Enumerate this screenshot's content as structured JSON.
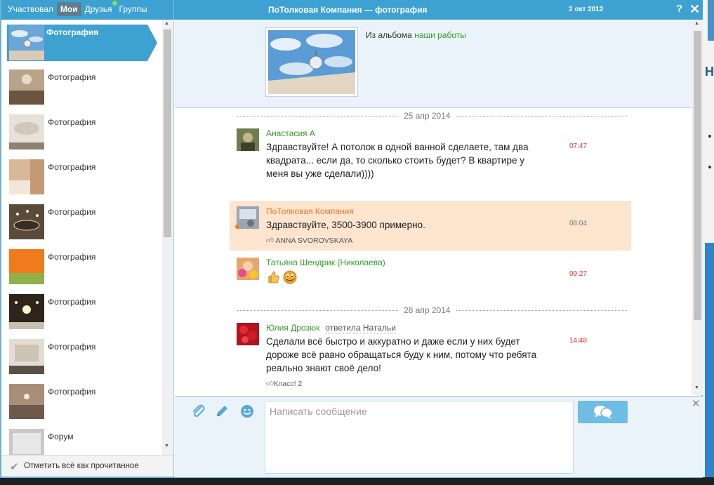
{
  "tabs": [
    {
      "label": "Участвовал",
      "active": false
    },
    {
      "label": "Мои",
      "active": true
    },
    {
      "label": "Друзья",
      "active": false,
      "online": true
    },
    {
      "label": "Группы",
      "active": false
    }
  ],
  "window": {
    "title": "ПоТолковая Компания — фотография",
    "date": "2 окт 2012",
    "help": "?",
    "close": "✕"
  },
  "sidebar": {
    "items": [
      {
        "label": "Фотография",
        "active": true
      },
      {
        "label": "Фотография"
      },
      {
        "label": "Фотография"
      },
      {
        "label": "Фотография"
      },
      {
        "label": "Фотография"
      },
      {
        "label": "Фотография"
      },
      {
        "label": "Фотография"
      },
      {
        "label": "Фотография"
      },
      {
        "label": "Фотография"
      },
      {
        "label": "Форум"
      }
    ],
    "mark_all_read": "Отметить всё как прочитанное"
  },
  "album": {
    "from_prefix": "Из альбома",
    "album_link": "наши работы"
  },
  "messages": {
    "day1": "25 апр 2014",
    "day2": "28 апр 2014",
    "m1": {
      "author": "Анастасия А",
      "text": "Здравствуйте! А потолок в одной ванной сделаете, там два квадрата... если да, то сколько стоить будет? В квартире у меня вы уже сделали))))",
      "time": "07:47"
    },
    "m2": {
      "author": "ПоТолковая Компания",
      "text": "Здравствуйте, 3500-3900 примерно.",
      "time": "08:04",
      "meta": "ANNA SVOROVSKAYA"
    },
    "m3": {
      "author": "Татьяна Шендрик (Николаева)",
      "time": "09:27"
    },
    "m4": {
      "author": "Юлия Дрозюк",
      "reply": "ответила Натальи",
      "text": "Сделали всё быстро и аккуратно и даже если у них будет дороже всё равно обращаться буду к ним, потому что ребята реально знают своё дело!",
      "time": "14:48",
      "meta": "Класс! 2"
    }
  },
  "compose": {
    "placeholder": "Написать сообщение"
  },
  "colors": {
    "accent": "#3da1d2",
    "name_green": "#339a2a",
    "own_bg": "#fce4cf",
    "own_name": "#ee7a2b",
    "time_red": "#e0352b"
  }
}
